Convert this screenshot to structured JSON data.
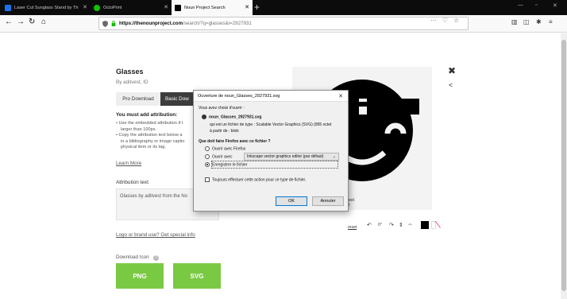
{
  "tabs": [
    {
      "label": "Laser Cut Sunglass Stand by Th",
      "active": false
    },
    {
      "label": "OctoPrint",
      "active": false
    },
    {
      "label": "Noun Project Search",
      "active": true
    }
  ],
  "nav": {
    "url_host": "https://thenounproject.com",
    "url_path": "/search/?q=glasses&i=2927931",
    "more_label": "···"
  },
  "icon": {
    "title": "Glasses",
    "author": "By aditvest, ID",
    "tab_pro": "Pro Download",
    "tab_basic": "Basic Dow",
    "attribution_heading": "You must add attribution:",
    "bullet1_line1": "Use the embedded attribution if t",
    "bullet1_line2": "larger than 100px.",
    "bullet2_line1": "Copy the attribution text below a",
    "bullet2_line2": "in a bibliography or image captio",
    "bullet2_line3": "physical item or its tag.",
    "learn_more": "Learn More",
    "attribution_text_label": "Attribution text",
    "attribution_text": "Glasses by aditvest from the No",
    "logo_link": "Logo or brand use? Get special info",
    "download_label": "Download Icon",
    "png_label": "PNG",
    "svg_label": "SVG",
    "caption_line1": "vest",
    "caption_line2": "ct",
    "reset_label": "reset"
  },
  "dialog": {
    "title": "Ouverture de noun_Glasses_2927931.svg",
    "intro": "Vous avez choisi d'ouvrir :",
    "filename": "noun_Glasses_2927931.svg",
    "filetype": "qui est un fichier de type : Scalable Vector Graphics (SVG) (895 octet",
    "source": "à partir de : blob:",
    "question": "Que doit faire Firefox avec ce fichier ?",
    "option_open_with": "Ouvrir avec Firefox",
    "option_open": "Ouvrir avec",
    "app_select": "Inkscape vector graphics editor (par défaut)",
    "option_save": "Enregistrer le fichier",
    "always_checkbox": "Toujours effectuer cette action pour ce type de fichier.",
    "ok_label": "OK",
    "cancel_label": "Annuler"
  },
  "colors": {
    "green": "#7ac943",
    "dark_tab": "#0c0c0d",
    "swatch_black": "#000000",
    "swatch_red": "#d70022"
  }
}
